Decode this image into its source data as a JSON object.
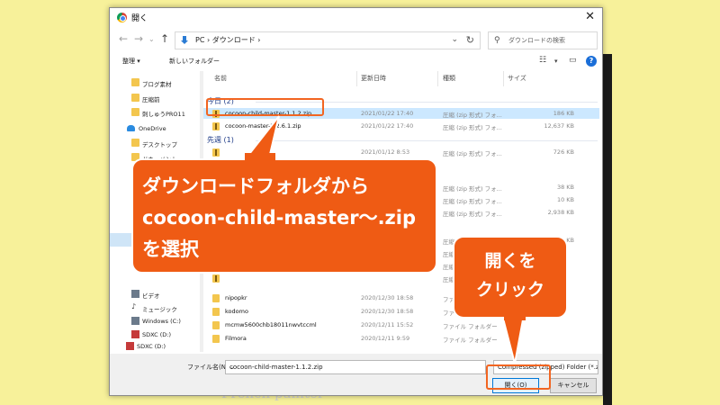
{
  "window": {
    "title": "開く"
  },
  "nav": {
    "back_icon": "arrow-left-icon",
    "address_segments": "PC › ダウンロード ›",
    "search_placeholder": "ダウンロードの検索"
  },
  "toolbar": {
    "organize": "整理 ▾",
    "new_folder": "新しいフォルダー"
  },
  "sidebar": {
    "items": [
      {
        "label": "ブログ素材",
        "icon": "folder-icon"
      },
      {
        "label": "圧縮前",
        "icon": "folder-icon"
      },
      {
        "label": "刺しゅうPRO11",
        "icon": "folder-icon"
      },
      {
        "label": "OneDrive",
        "icon": "cloud-icon"
      },
      {
        "label": "デスクトップ",
        "icon": "folder-icon"
      },
      {
        "label": "ドキュメント",
        "icon": "folder-icon"
      },
      {
        "label": "ビデオ",
        "icon": "folder-icon"
      },
      {
        "label": "ミュージック",
        "icon": "music-icon"
      },
      {
        "label": "Windows (C:)",
        "icon": "drive-icon"
      },
      {
        "label": "SDXC (D:)",
        "icon": "sd-card-icon"
      },
      {
        "label": "SDXC (D:)",
        "icon": "sd-card-icon"
      }
    ]
  },
  "columns": {
    "name": "名前",
    "date": "更新日時",
    "type": "種類",
    "size": "サイズ"
  },
  "groups": {
    "today": "今日 (2)",
    "last_week": "先週 (1)"
  },
  "files": [
    {
      "name": "cocoon-child-master-1.1.2.zip",
      "date": "2021/01/22 17:40",
      "type": "圧縮 (zip 形式) フォ...",
      "size": "186 KB",
      "selected": true,
      "zip": true
    },
    {
      "name": "cocoon-master-2.2.6.1.zip",
      "date": "2021/01/22 17:40",
      "type": "圧縮 (zip 形式) フォ...",
      "size": "12,637 KB",
      "selected": false,
      "zip": true
    },
    {
      "name": "",
      "date": "2021/01/12 8:53",
      "type": "圧縮 (zip 形式) フォ...",
      "size": "726 KB",
      "selected": false,
      "zip": true
    },
    {
      "name": "",
      "date": "",
      "type": "圧縮 (zip 形式) フォ...",
      "size": "38 KB",
      "selected": false,
      "zip": true
    },
    {
      "name": "",
      "date": "",
      "type": "圧縮 (zip 形式) フォ...",
      "size": "10 KB",
      "selected": false,
      "zip": true
    },
    {
      "name": "",
      "date": "",
      "type": "圧縮 (zip 形式) フォ...",
      "size": "2,938 KB",
      "selected": false,
      "zip": true
    },
    {
      "name": "",
      "date": "",
      "type": "圧縮 (zip 形式) フォ...",
      "size": "12,154 KB",
      "selected": false,
      "zip": true
    },
    {
      "name": "",
      "date": "",
      "type": "圧縮",
      "size": "",
      "selected": false,
      "zip": true
    },
    {
      "name": "",
      "date": "",
      "type": "圧縮",
      "size": "",
      "selected": false,
      "zip": true
    },
    {
      "name": "",
      "date": "",
      "type": "圧縮",
      "size": "",
      "selected": false,
      "zip": true
    },
    {
      "name": "nipopkr",
      "date": "2020/12/30 18:58",
      "type": "ファイル フォルダー",
      "size": "",
      "selected": false,
      "zip": false
    },
    {
      "name": "kodomo",
      "date": "2020/12/30 18:58",
      "type": "ファイル フォルダー",
      "size": "",
      "selected": false,
      "zip": false
    },
    {
      "name": "mcmw5600chb18011nwvtccml",
      "date": "2020/12/11 15:52",
      "type": "ファイル フォルダー",
      "size": "",
      "selected": false,
      "zip": false
    },
    {
      "name": "Filmora",
      "date": "2020/12/11 9:59",
      "type": "ファイル フォルダー",
      "size": "",
      "selected": false,
      "zip": false
    }
  ],
  "footer": {
    "filename_label": "ファイル名(N):",
    "filename_value": "cocoon-child-master-1.1.2.zip",
    "filetype_value": "Compressed (zipped) Folder (*.zip)",
    "open_button": "開く(O)",
    "cancel_button": "キャンセル"
  },
  "annotations": {
    "callout1": [
      "ダウンロードフォルダから",
      "cocoon-child-master〜.zip",
      "を選択"
    ],
    "callout2": [
      "開くを",
      "クリック"
    ]
  },
  "background": {
    "behind_text": "French painter"
  },
  "colors": {
    "accent": "#ef5b14",
    "selection": "#cce8ff",
    "link_blue": "#1e3b87"
  }
}
